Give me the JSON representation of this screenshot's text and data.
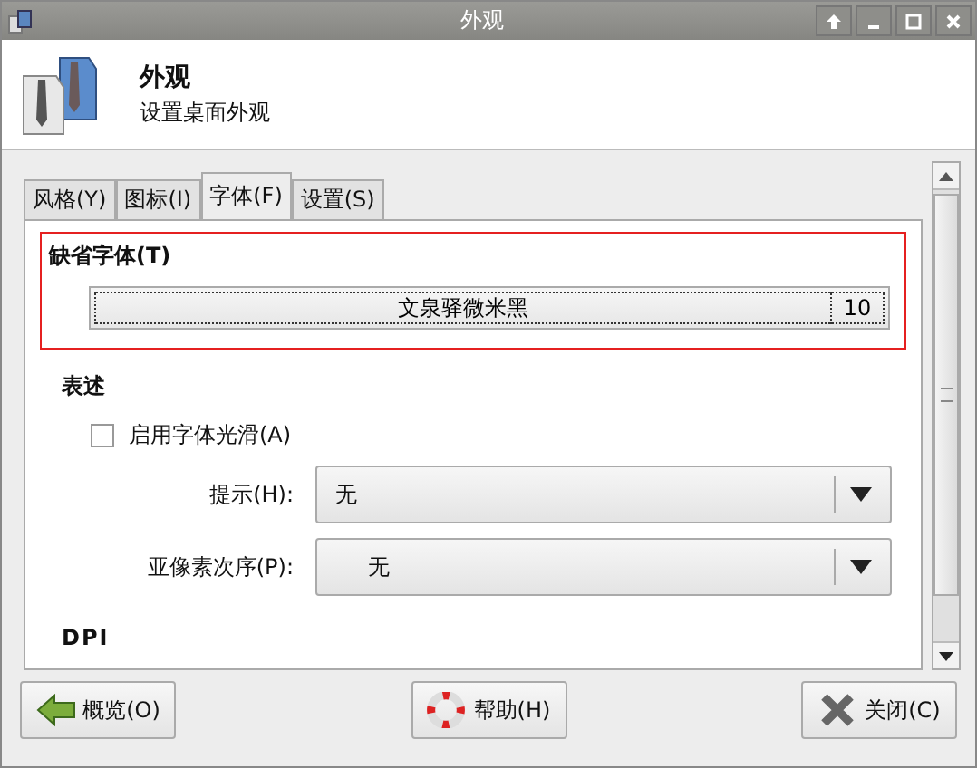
{
  "window": {
    "title": "外观"
  },
  "header": {
    "title": "外观",
    "subtitle": "设置桌面外观"
  },
  "tabs": [
    {
      "label": "风格(Y)",
      "selected": false
    },
    {
      "label": "图标(I)",
      "selected": false
    },
    {
      "label": "字体(F)",
      "selected": true
    },
    {
      "label": "设置(S)",
      "selected": false
    }
  ],
  "default_font": {
    "heading": "缺省字体(T)",
    "highlighted": true,
    "font_name": "文泉驿微米黑",
    "font_size": "10"
  },
  "rendering": {
    "heading": "表述",
    "antialias": {
      "label": "启用字体光滑(A)",
      "checked": false
    },
    "dropdowns": [
      {
        "label": "提示(H):",
        "value": "无"
      },
      {
        "label": "亚像素次序(P):",
        "value": "无"
      }
    ]
  },
  "dpi": {
    "heading": "DPI"
  },
  "buttons": [
    {
      "kind": "overview",
      "label": "概览(O)"
    },
    {
      "kind": "help",
      "label": "帮助(H)"
    },
    {
      "kind": "close",
      "label": "关闭(C)"
    }
  ]
}
